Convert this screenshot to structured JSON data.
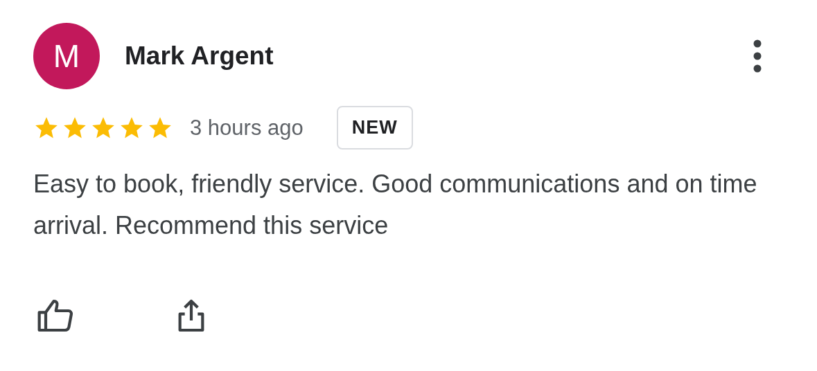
{
  "review": {
    "avatar_letter": "M",
    "color": "#c2185b",
    "author": "Mark Argent",
    "stars": 5,
    "time": "3 hours ago",
    "badge": "NEW",
    "text": "Easy to book, friendly service. Good communications and on time arrival. Recommend this service"
  }
}
